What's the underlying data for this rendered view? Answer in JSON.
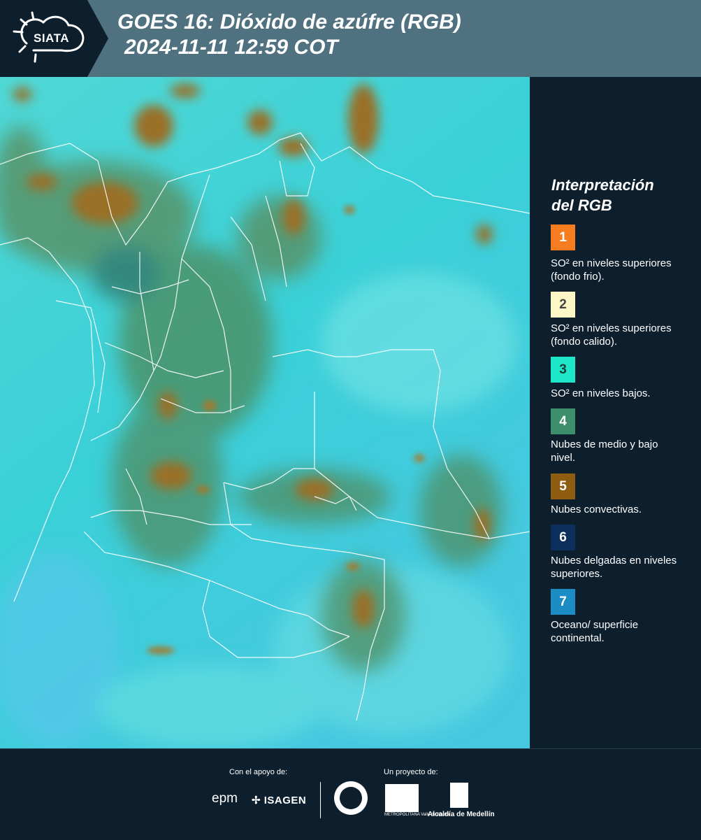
{
  "header": {
    "logo_text": "SIATA",
    "title_line1": "GOES 16: Dióxido de azúfre (RGB)",
    "title_line2": "2024-11-11 12:59 COT"
  },
  "legend": {
    "title_line1": "Interpretación",
    "title_line2": "del RGB",
    "items": [
      {
        "number": "1",
        "color": "#f57c1f",
        "num_color": "#ffffff",
        "text": "SO² en niveles superiores (fondo frio)."
      },
      {
        "number": "2",
        "color": "#fdf7c8",
        "num_color": "#444444",
        "text": "SO² en niveles superiores (fondo calido)."
      },
      {
        "number": "3",
        "color": "#1ee6c8",
        "num_color": "#1a3a3a",
        "text": "SO² en niveles bajos."
      },
      {
        "number": "4",
        "color": "#3c8f6a",
        "num_color": "#ffffff",
        "text": "Nubes de medio y bajo nivel."
      },
      {
        "number": "5",
        "color": "#8f5d12",
        "num_color": "#ffffff",
        "text": "Nubes convectivas."
      },
      {
        "number": "6",
        "color": "#0c2f5e",
        "num_color": "#ffffff",
        "text": "Nubes delgadas en niveles superiores."
      },
      {
        "number": "7",
        "color": "#1b8cc4",
        "num_color": "#ffffff",
        "text": "Oceano/ superficie continental."
      }
    ]
  },
  "footer": {
    "support_label": "Con el apoyo de:",
    "project_label": "Un proyecto de:",
    "sponsor1": "epm",
    "sponsor2": "ISAGEN",
    "partner1": "METROPOLITANA Valle de Aburrá",
    "partner2": "Alcaldía de Medellín"
  }
}
